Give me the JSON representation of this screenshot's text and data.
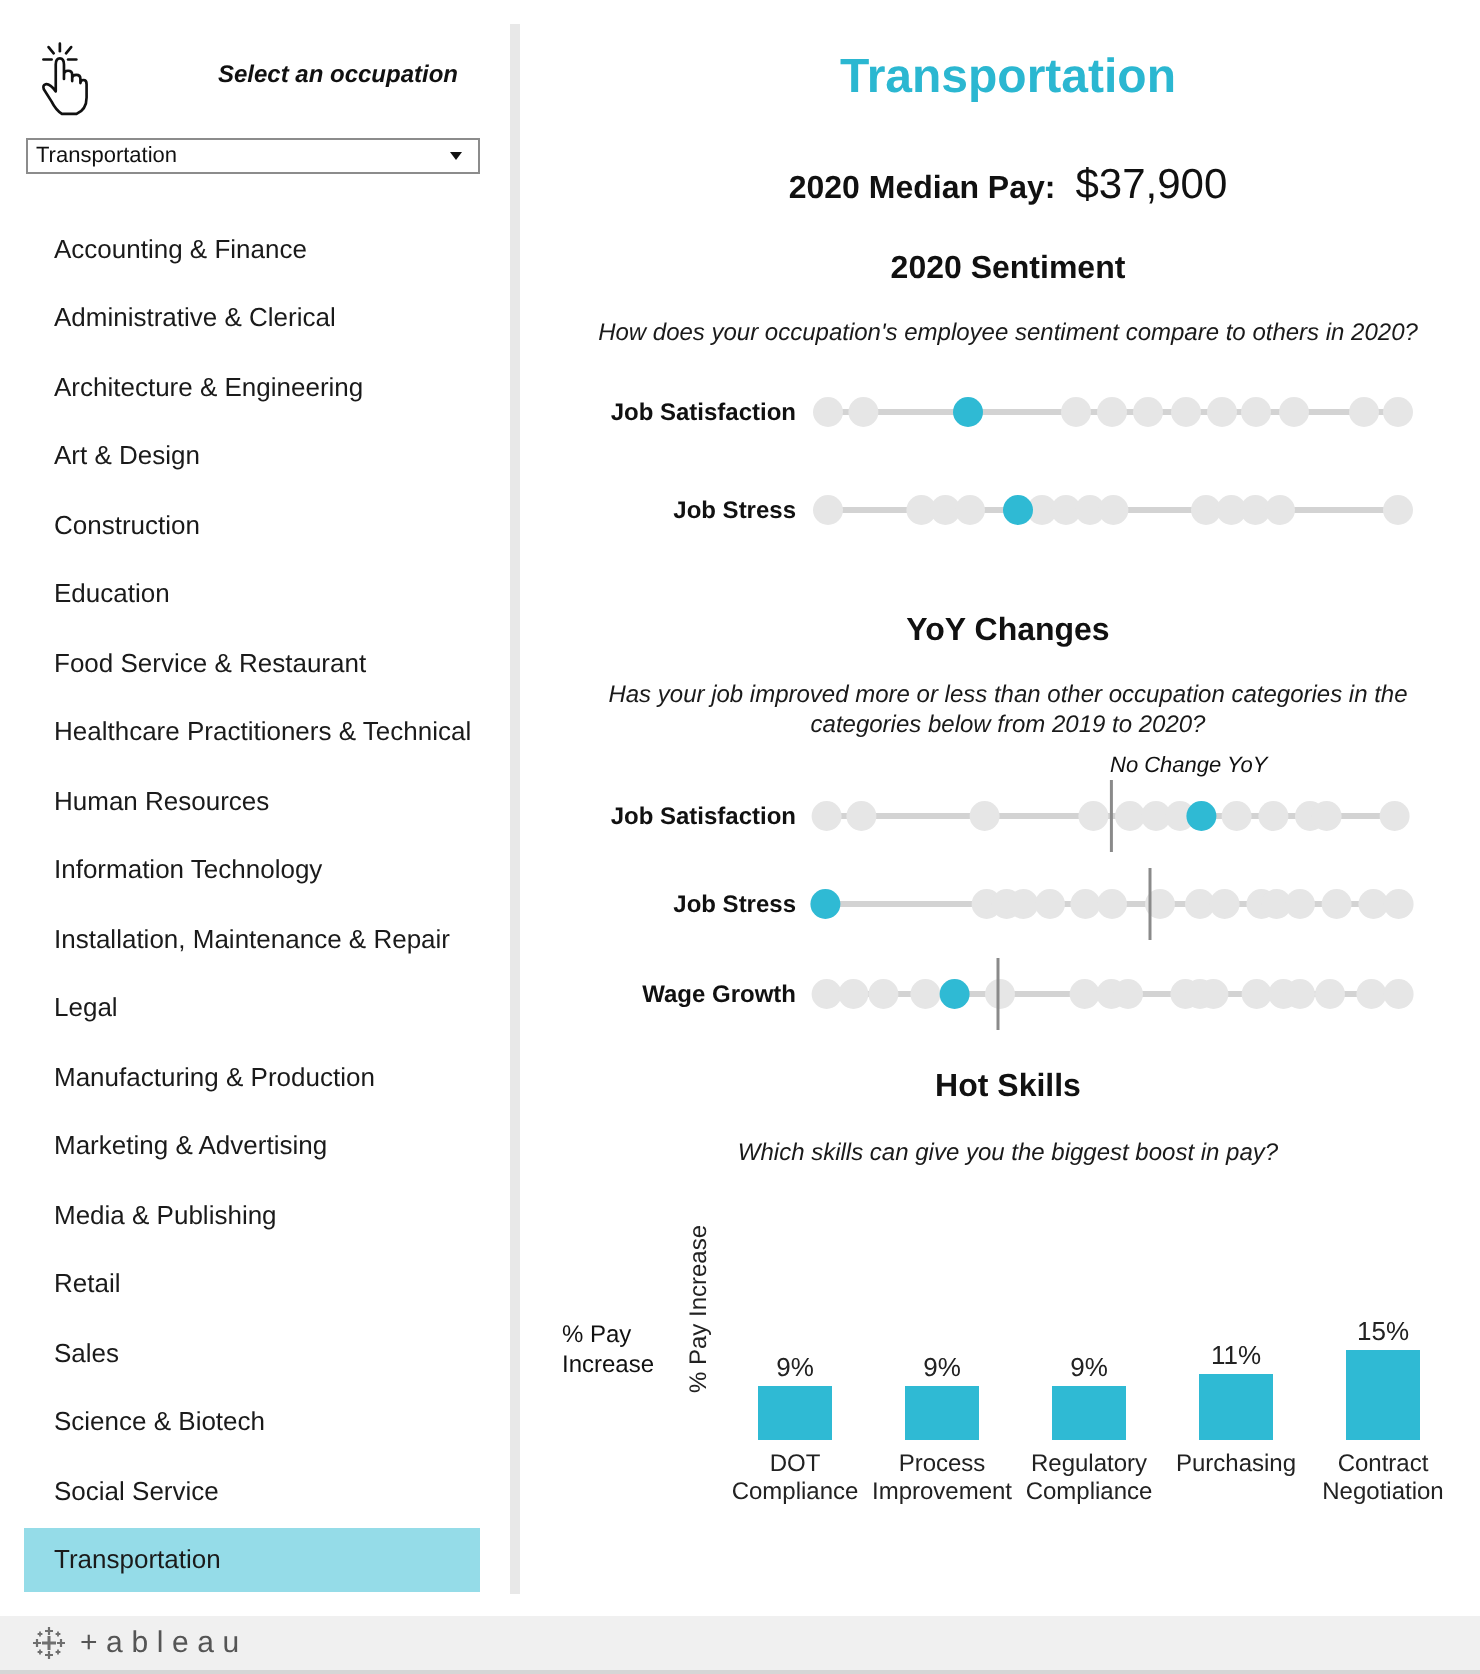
{
  "sidebar": {
    "title": "Select an occupation",
    "dropdown": {
      "value": "Transportation"
    },
    "items": [
      {
        "label": "Accounting & Finance",
        "selected": false
      },
      {
        "label": "Administrative & Clerical",
        "selected": false
      },
      {
        "label": "Architecture & Engineering",
        "selected": false
      },
      {
        "label": "Art & Design",
        "selected": false
      },
      {
        "label": "Construction",
        "selected": false
      },
      {
        "label": "Education",
        "selected": false
      },
      {
        "label": "Food Service & Restaurant",
        "selected": false
      },
      {
        "label": "Healthcare Practitioners & Technical",
        "selected": false
      },
      {
        "label": "Human Resources",
        "selected": false
      },
      {
        "label": "Information Technology",
        "selected": false
      },
      {
        "label": "Installation, Maintenance & Repair",
        "selected": false
      },
      {
        "label": "Legal",
        "selected": false
      },
      {
        "label": "Manufacturing & Production",
        "selected": false
      },
      {
        "label": "Marketing & Advertising",
        "selected": false
      },
      {
        "label": "Media & Publishing",
        "selected": false
      },
      {
        "label": "Retail",
        "selected": false
      },
      {
        "label": "Sales",
        "selected": false
      },
      {
        "label": "Science & Biotech",
        "selected": false
      },
      {
        "label": "Social Service",
        "selected": false
      },
      {
        "label": "Transportation",
        "selected": true
      }
    ]
  },
  "main": {
    "title": "Transportation",
    "median_pay": {
      "label": "2020 Median Pay:",
      "value": "$37,900"
    },
    "sentiment": {
      "heading": "2020 Sentiment",
      "question": "How does your occupation's employee sentiment compare to others in 2020?",
      "rows": [
        {
          "label": "Job Satisfaction"
        },
        {
          "label": "Job Stress"
        }
      ]
    },
    "yoy": {
      "heading": "YoY Changes",
      "question": "Has your job improved more or less than other occupation categories in the categories below from 2019 to 2020?",
      "annotation": "No Change YoY",
      "rows": [
        {
          "label": "Job Satisfaction"
        },
        {
          "label": "Job Stress"
        },
        {
          "label": "Wage Growth"
        }
      ]
    },
    "hot_skills": {
      "heading": "Hot Skills",
      "question": "Which skills can give you the biggest boost in pay?",
      "row_header": "% Pay Increase",
      "chart_data": {
        "type": "bar",
        "ylabel": "% Pay Increase",
        "categories": [
          "DOT Compliance",
          "Process Improvement",
          "Regulatory Compliance",
          "Purchasing",
          "Contract Negotiation"
        ],
        "values": [
          9,
          9,
          9,
          11,
          15
        ],
        "value_labels": [
          "9%",
          "9%",
          "9%",
          "11%",
          "15%"
        ]
      }
    }
  },
  "footer": {
    "brand": "+ableau"
  }
}
